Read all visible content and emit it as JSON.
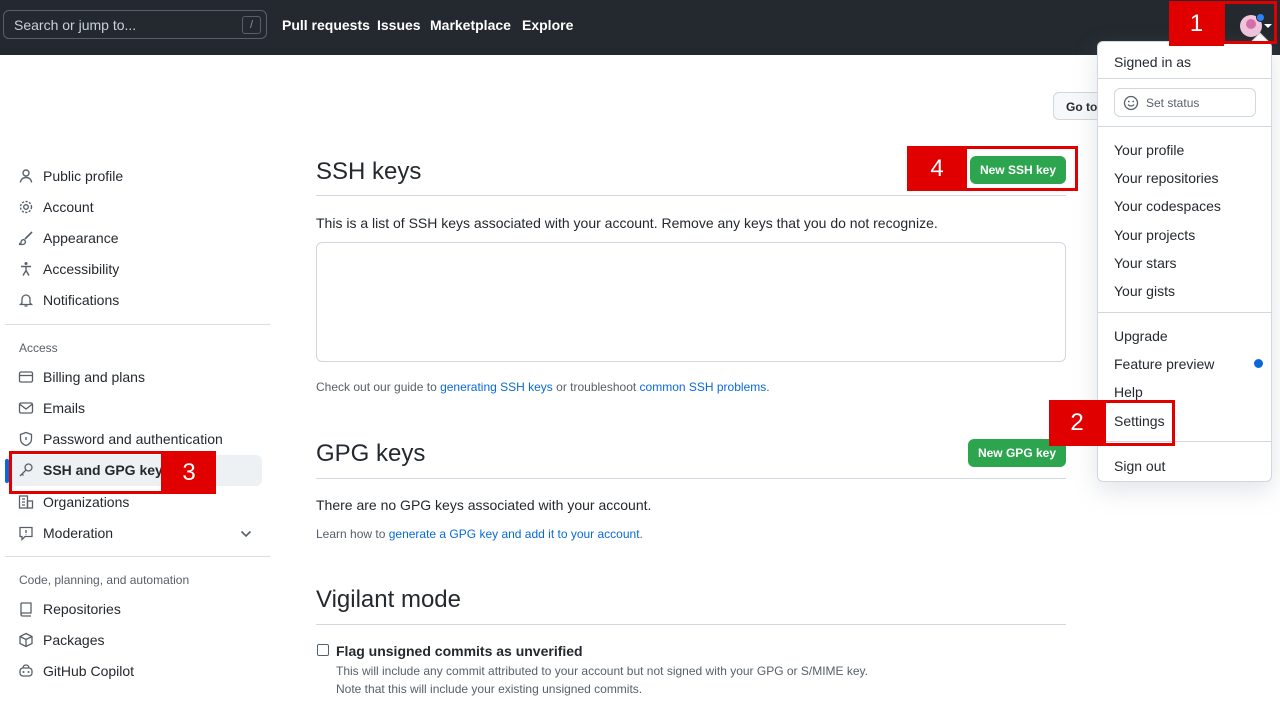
{
  "header": {
    "search_placeholder": "Search or jump to...",
    "search_shortcut": "/",
    "nav": [
      "Pull requests",
      "Issues",
      "Marketplace",
      "Explore"
    ]
  },
  "sidebar": {
    "items_top": [
      "Public profile",
      "Account",
      "Appearance",
      "Accessibility",
      "Notifications"
    ],
    "section_access": "Access",
    "items_access": [
      "Billing and plans",
      "Emails",
      "Password and authentication",
      "SSH and GPG keys",
      "Organizations",
      "Moderation"
    ],
    "section_code": "Code, planning, and automation",
    "items_code": [
      "Repositories",
      "Packages",
      "GitHub Copilot"
    ]
  },
  "main": {
    "goto_label": "Go to",
    "ssh": {
      "title": "SSH keys",
      "button": "New SSH key",
      "desc": "This is a list of SSH keys associated with your account. Remove any keys that you do not recognize.",
      "help_1": "Check out our guide to ",
      "help_link_1": "generating SSH keys",
      "help_2": " or troubleshoot ",
      "help_link_2": "common SSH problems",
      "help_3": "."
    },
    "gpg": {
      "title": "GPG keys",
      "button": "New GPG key",
      "desc": "There are no GPG keys associated with your account.",
      "help_1": "Learn how to ",
      "help_link": "generate a GPG key and add it to your account",
      "help_2": "."
    },
    "vigilant": {
      "title": "Vigilant mode",
      "checkbox_label": "Flag unsigned commits as unverified",
      "desc_1": "This will include any commit attributed to your account but not signed with your GPG or S/MIME key.",
      "desc_2": "Note that this will include your existing unsigned commits."
    }
  },
  "dropdown": {
    "signed_in": "Signed in as",
    "set_status": "Set status",
    "group1": [
      "Your profile",
      "Your repositories",
      "Your codespaces",
      "Your projects",
      "Your stars",
      "Your gists"
    ],
    "group2": [
      "Upgrade",
      "Feature preview",
      "Help",
      "Settings"
    ],
    "sign_out": "Sign out"
  },
  "annotations": [
    "1",
    "2",
    "3",
    "4"
  ],
  "colors": {
    "header_bg": "#24292f",
    "green": "#2da44e",
    "link": "#0969da",
    "annotation": "#e00000"
  }
}
